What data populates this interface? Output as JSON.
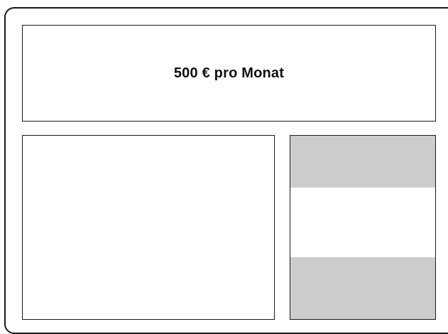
{
  "header": {
    "title": "500 € pro Monat"
  },
  "colors": {
    "border": "#1a1a1a",
    "placeholder_fill": "#cccccc",
    "background": "#ffffff"
  }
}
